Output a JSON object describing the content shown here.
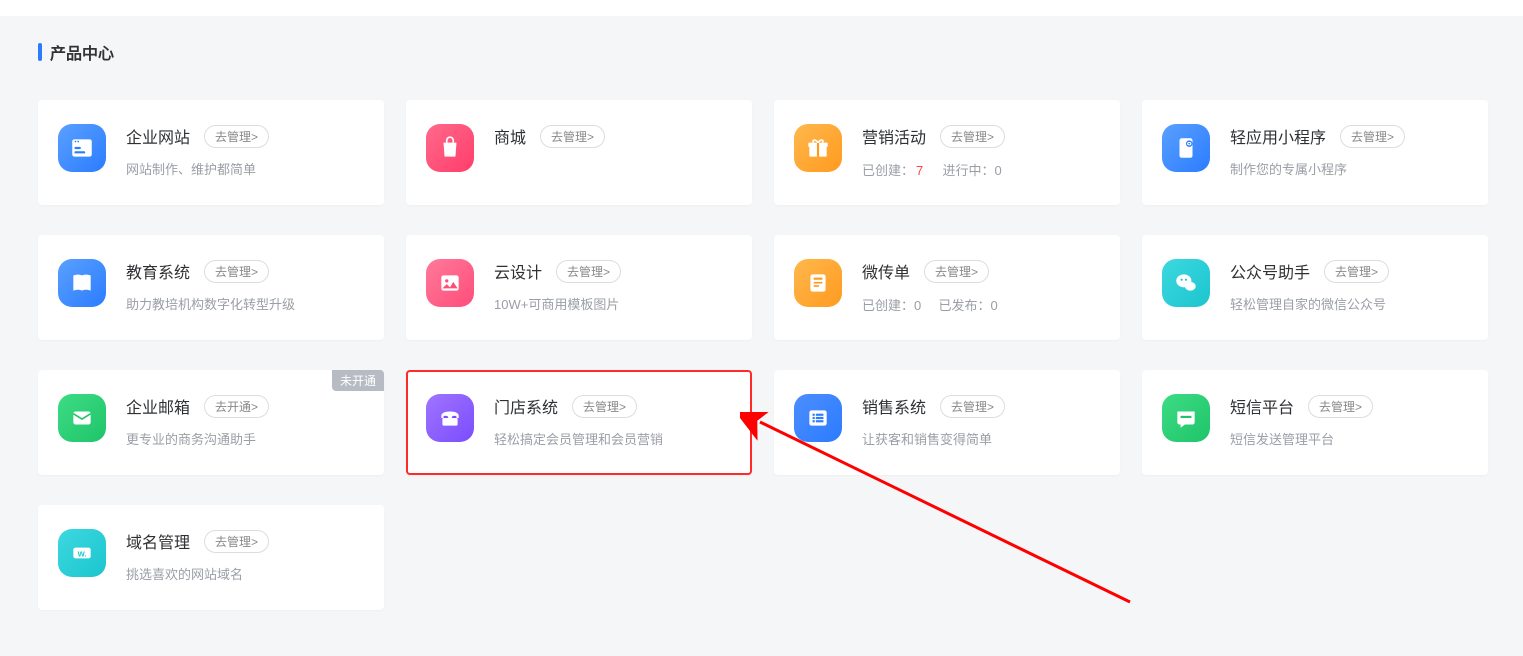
{
  "section_title": "产品中心",
  "badge_unopened": "未开通",
  "cards": [
    {
      "title": "企业网站",
      "btn": "去管理>",
      "desc": "网站制作、维护都简单"
    },
    {
      "title": "商城",
      "btn": "去管理>",
      "desc": ""
    },
    {
      "title": "营销活动",
      "btn": "去管理>",
      "stats": {
        "created_label": "已创建：",
        "created_value": "7",
        "progress_label": "进行中：",
        "progress_value": "0"
      }
    },
    {
      "title": "轻应用小程序",
      "btn": "去管理>",
      "desc": "制作您的专属小程序"
    },
    {
      "title": "教育系统",
      "btn": "去管理>",
      "desc": "助力教培机构数字化转型升级"
    },
    {
      "title": "云设计",
      "btn": "去管理>",
      "desc": "10W+可商用模板图片"
    },
    {
      "title": "微传单",
      "btn": "去管理>",
      "stats": {
        "created_label": "已创建：",
        "created_value": "0",
        "progress_label": "已发布：",
        "progress_value": "0"
      }
    },
    {
      "title": "公众号助手",
      "btn": "去管理>",
      "desc": "轻松管理自家的微信公众号"
    },
    {
      "title": "企业邮箱",
      "btn": "去开通>",
      "desc": "更专业的商务沟通助手"
    },
    {
      "title": "门店系统",
      "btn": "去管理>",
      "desc": "轻松搞定会员管理和会员营销"
    },
    {
      "title": "销售系统",
      "btn": "去管理>",
      "desc": "让获客和销售变得简单"
    },
    {
      "title": "短信平台",
      "btn": "去管理>",
      "desc": "短信发送管理平台"
    },
    {
      "title": "域名管理",
      "btn": "去管理>",
      "desc": "挑选喜欢的网站域名"
    }
  ]
}
